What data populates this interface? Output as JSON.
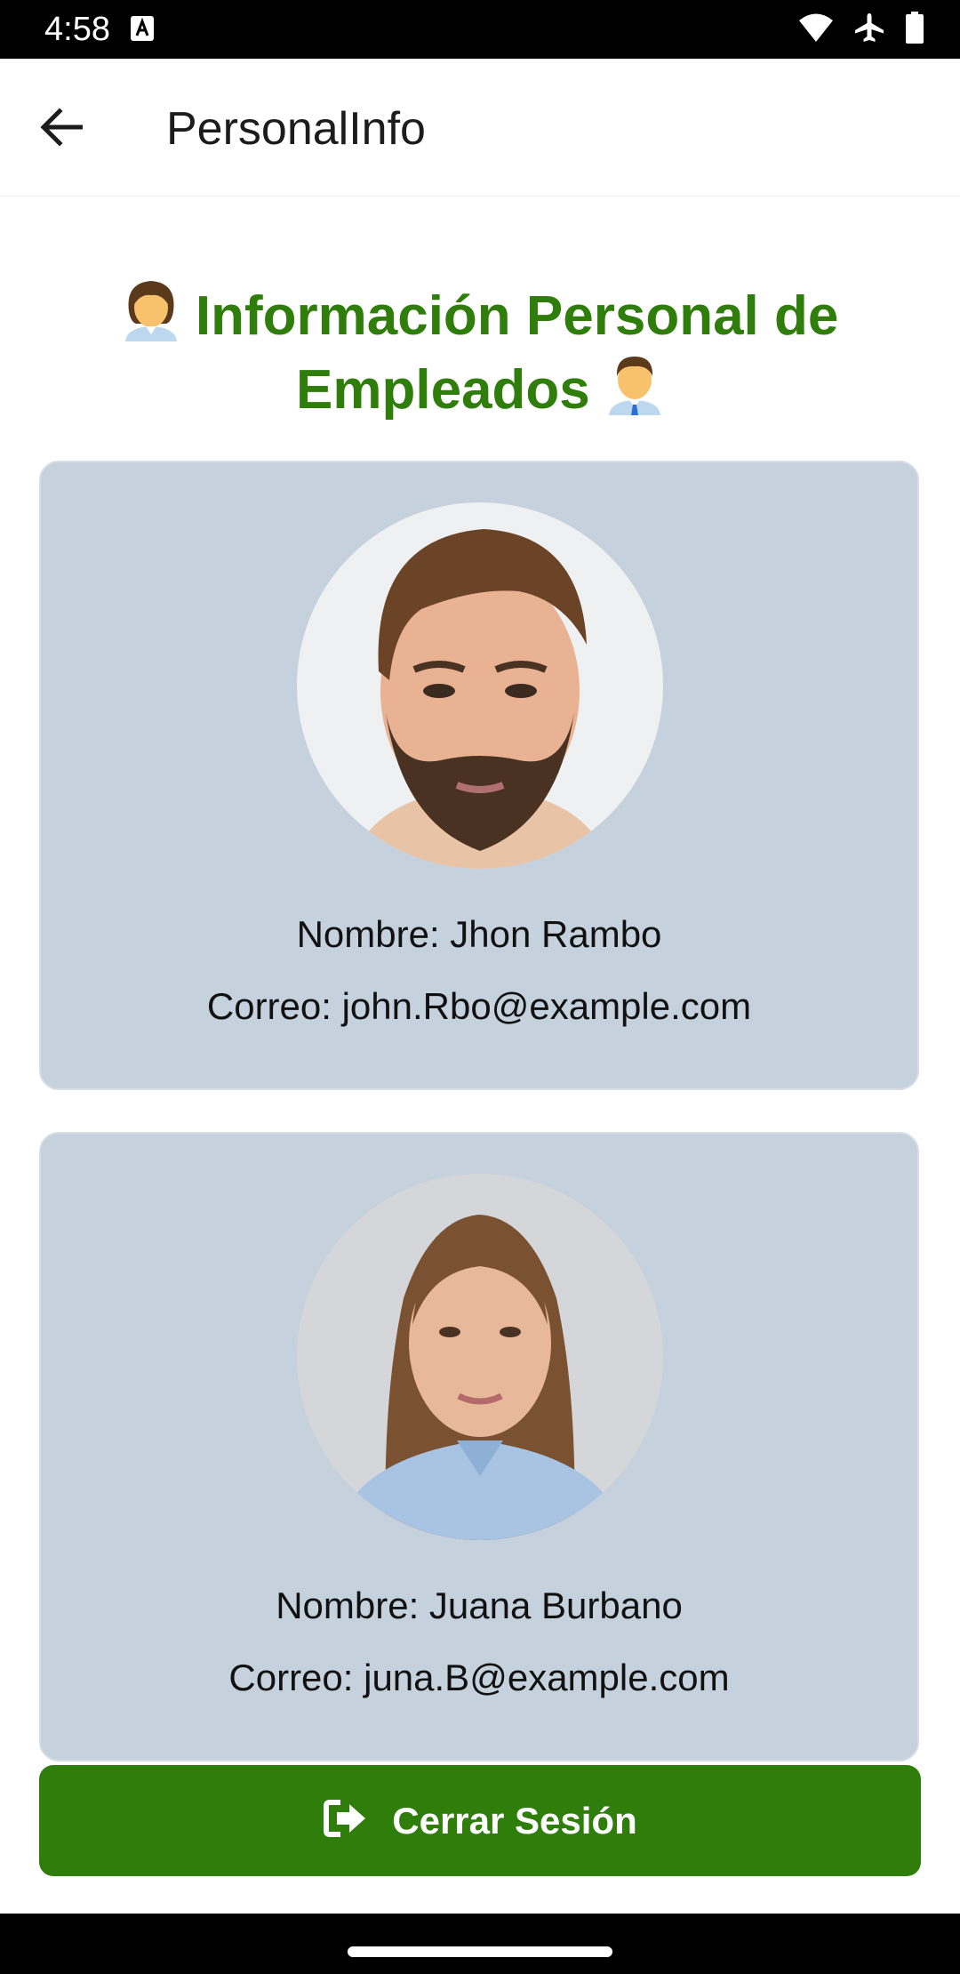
{
  "status_bar": {
    "time": "4:58"
  },
  "app_bar": {
    "title": "PersonalInfo"
  },
  "heading": {
    "line1": "Información Personal de",
    "line2": "Empleados"
  },
  "employees": [
    {
      "name_label": "Nombre: Jhon Rambo",
      "email_label": "Correo: john.Rbo@example.com"
    },
    {
      "name_label": "Nombre: Juana Burbano",
      "email_label": "Correo: juna.B@example.com"
    }
  ],
  "logout": {
    "label": "Cerrar Sesión",
    "icon": "sign-out-icon"
  },
  "colors": {
    "accent_green": "#2f7d0b",
    "card_background": "#c5d1dd"
  }
}
